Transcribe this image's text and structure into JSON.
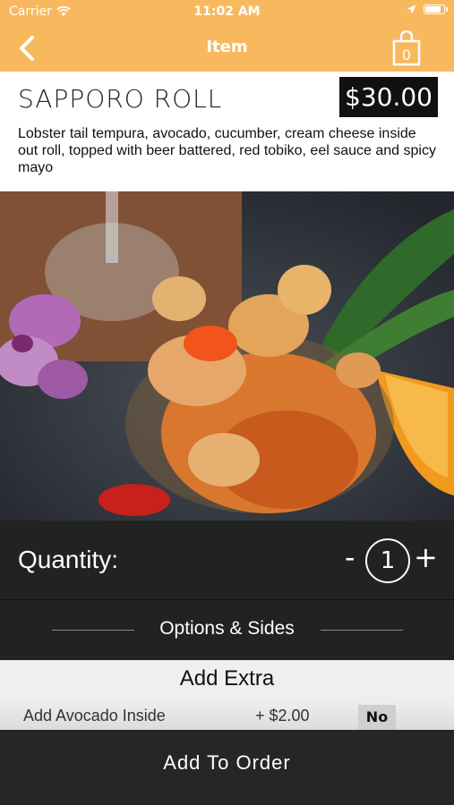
{
  "status_bar": {
    "carrier": "Carrier",
    "time": "11:02 AM"
  },
  "nav": {
    "title": "Item",
    "back_icon": "chevron-left-icon",
    "cart_icon": "shopping-bag-icon",
    "cart_count": "0"
  },
  "item": {
    "name": "SAPPORO ROLL",
    "price": "$30.00",
    "description": "Lobster tail tempura, avocado, cucumber, cream cheese inside out roll, topped with beer battered, red tobiko, eel sauce and spicy mayo"
  },
  "quantity": {
    "label": "Quantity:",
    "minus": "-",
    "value": "1",
    "plus": "+"
  },
  "options": {
    "label": "Options & Sides"
  },
  "extras": {
    "title": "Add Extra",
    "rows": [
      {
        "name": "Add Avocado Inside",
        "price": "+ $2.00",
        "toggle": "No"
      }
    ]
  },
  "add_to_order": {
    "label": "Add To Order"
  },
  "colors": {
    "accent": "#f8b95e",
    "dark": "#222222"
  }
}
